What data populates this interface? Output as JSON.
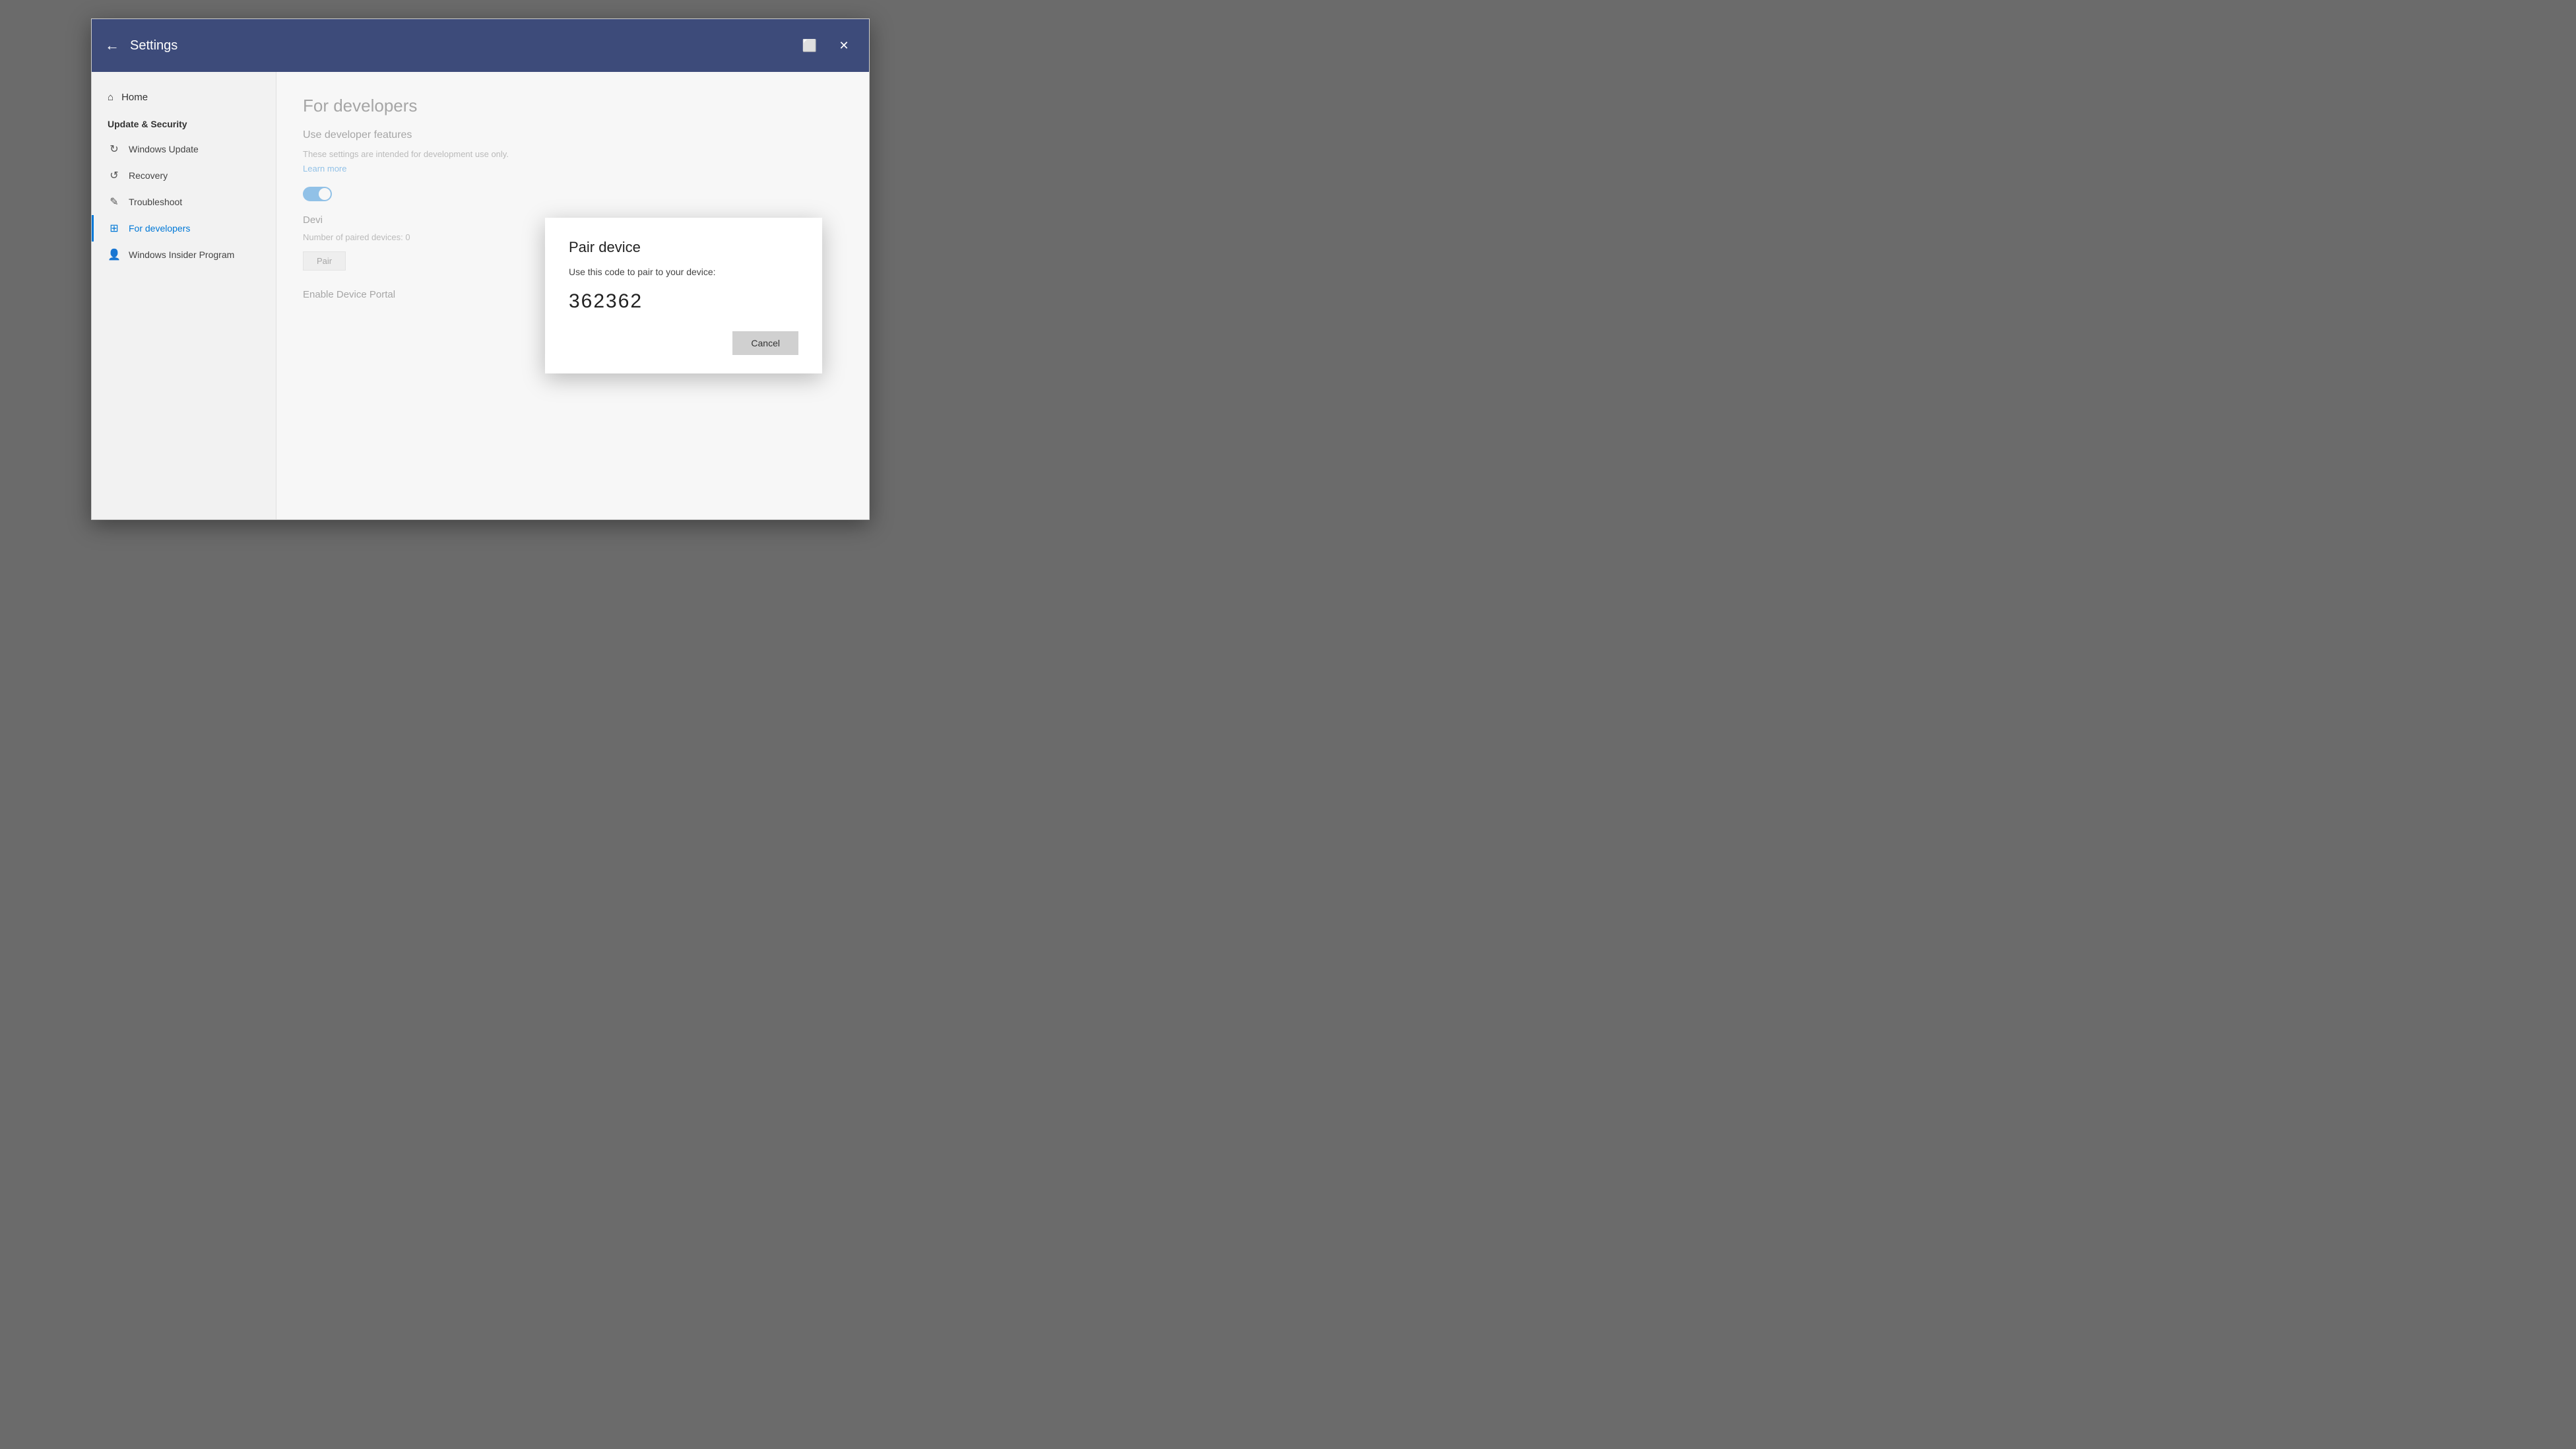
{
  "window": {
    "title": "Settings",
    "back_label": "←",
    "restore_icon": "⬜",
    "close_icon": "✕"
  },
  "sidebar": {
    "home_label": "Home",
    "section_title": "Update & Security",
    "items": [
      {
        "id": "windows-update",
        "label": "Windows Update",
        "icon": "↻"
      },
      {
        "id": "recovery",
        "label": "Recovery",
        "icon": "↺"
      },
      {
        "id": "troubleshoot",
        "label": "Troubleshoot",
        "icon": "✎"
      },
      {
        "id": "for-developers",
        "label": "For developers",
        "icon": "⊞",
        "active": true
      },
      {
        "id": "windows-insider",
        "label": "Windows Insider Program",
        "icon": "👤"
      }
    ]
  },
  "content": {
    "page_title": "For developers",
    "section_use_developer": "Use developer features",
    "description": "These settings are intended for development use only.",
    "learn_more": "Learn more",
    "device_section": "Devi",
    "paired_devices": "Number of paired devices: 0",
    "pair_button": "Pair",
    "enable_device_portal": "Enable Device Portal"
  },
  "dialog": {
    "title": "Pair device",
    "description": "Use this code to pair to your device:",
    "code": "362362",
    "cancel_label": "Cancel"
  }
}
